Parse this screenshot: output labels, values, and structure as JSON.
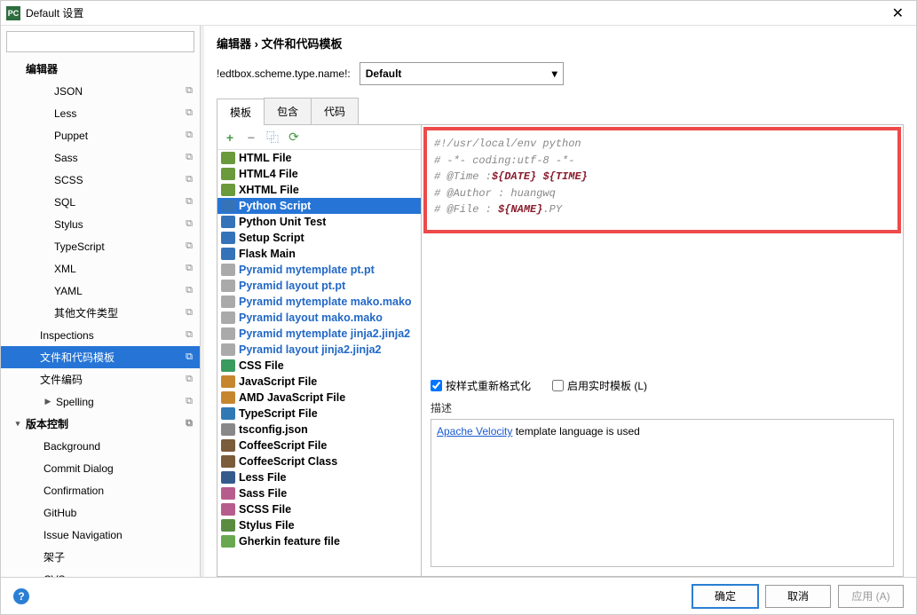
{
  "title": "Default 设置",
  "sidebar": {
    "section_editor": "编辑器",
    "items1": [
      "JSON",
      "Less",
      "Puppet",
      "Sass",
      "SCSS",
      "SQL",
      "Stylus",
      "TypeScript",
      "XML",
      "YAML",
      "其他文件类型"
    ],
    "inspections": "Inspections",
    "file_templates": "文件和代码模板",
    "file_encoding": "文件编码",
    "spelling": "Spelling",
    "section_vcs": "版本控制",
    "items2": [
      "Background",
      "Commit Dialog",
      "Confirmation",
      "GitHub",
      "Issue Navigation",
      "架子",
      "CVS"
    ]
  },
  "breadcrumb": "编辑器 › 文件和代码模板",
  "scheme_label": "!edtbox.scheme.type.name!:",
  "scheme_value": "Default",
  "tabs": [
    "模板",
    "包含",
    "代码"
  ],
  "templates": [
    {
      "label": "HTML File",
      "icon": "ic-h",
      "internal": false
    },
    {
      "label": "HTML4 File",
      "icon": "ic-h",
      "internal": false
    },
    {
      "label": "XHTML File",
      "icon": "ic-h",
      "internal": false
    },
    {
      "label": "Python Script",
      "icon": "ic-py",
      "internal": false,
      "selected": true
    },
    {
      "label": "Python Unit Test",
      "icon": "ic-py",
      "internal": false
    },
    {
      "label": "Setup Script",
      "icon": "ic-py",
      "internal": false
    },
    {
      "label": "Flask Main",
      "icon": "ic-py",
      "internal": false
    },
    {
      "label": "Pyramid mytemplate pt.pt",
      "icon": "ic-none",
      "internal": true
    },
    {
      "label": "Pyramid layout pt.pt",
      "icon": "ic-none",
      "internal": true
    },
    {
      "label": "Pyramid mytemplate mako.mako",
      "icon": "ic-none",
      "internal": true
    },
    {
      "label": "Pyramid layout mako.mako",
      "icon": "ic-none",
      "internal": true
    },
    {
      "label": "Pyramid mytemplate jinja2.jinja2",
      "icon": "ic-none",
      "internal": true
    },
    {
      "label": "Pyramid layout jinja2.jinja2",
      "icon": "ic-none",
      "internal": true
    },
    {
      "label": "CSS File",
      "icon": "ic-css",
      "internal": false
    },
    {
      "label": "JavaScript File",
      "icon": "ic-js",
      "internal": false
    },
    {
      "label": "AMD JavaScript File",
      "icon": "ic-js",
      "internal": false
    },
    {
      "label": "TypeScript File",
      "icon": "ic-ts",
      "internal": false
    },
    {
      "label": "tsconfig.json",
      "icon": "ic-json",
      "internal": false
    },
    {
      "label": "CoffeeScript File",
      "icon": "ic-cfee",
      "internal": false
    },
    {
      "label": "CoffeeScript Class",
      "icon": "ic-cfee",
      "internal": false
    },
    {
      "label": "Less File",
      "icon": "ic-less",
      "internal": false
    },
    {
      "label": "Sass File",
      "icon": "ic-sass",
      "internal": false
    },
    {
      "label": "SCSS File",
      "icon": "ic-sass",
      "internal": false
    },
    {
      "label": "Stylus File",
      "icon": "ic-styl",
      "internal": false
    },
    {
      "label": "Gherkin feature file",
      "icon": "ic-gher",
      "internal": false
    }
  ],
  "code": {
    "l1": "#!/usr/local/env python",
    "l2": "# -*- coding:utf-8 -*-",
    "l3a": "# @Time    :",
    "l3b": "${DATE}",
    "l3c": "${TIME}",
    "l4": "# @Author  : huangwq",
    "l5a": "# @File    :  ",
    "l5b": "${NAME}",
    "l5c": ".PY"
  },
  "opt_reformat": "按样式重新格式化",
  "opt_live": "启用实时模板 (L)",
  "desc_label": "描述",
  "desc_link": "Apache Velocity",
  "desc_rest": " template language is used",
  "btn_ok": "确定",
  "btn_cancel": "取消",
  "btn_apply": "应用 (A)"
}
